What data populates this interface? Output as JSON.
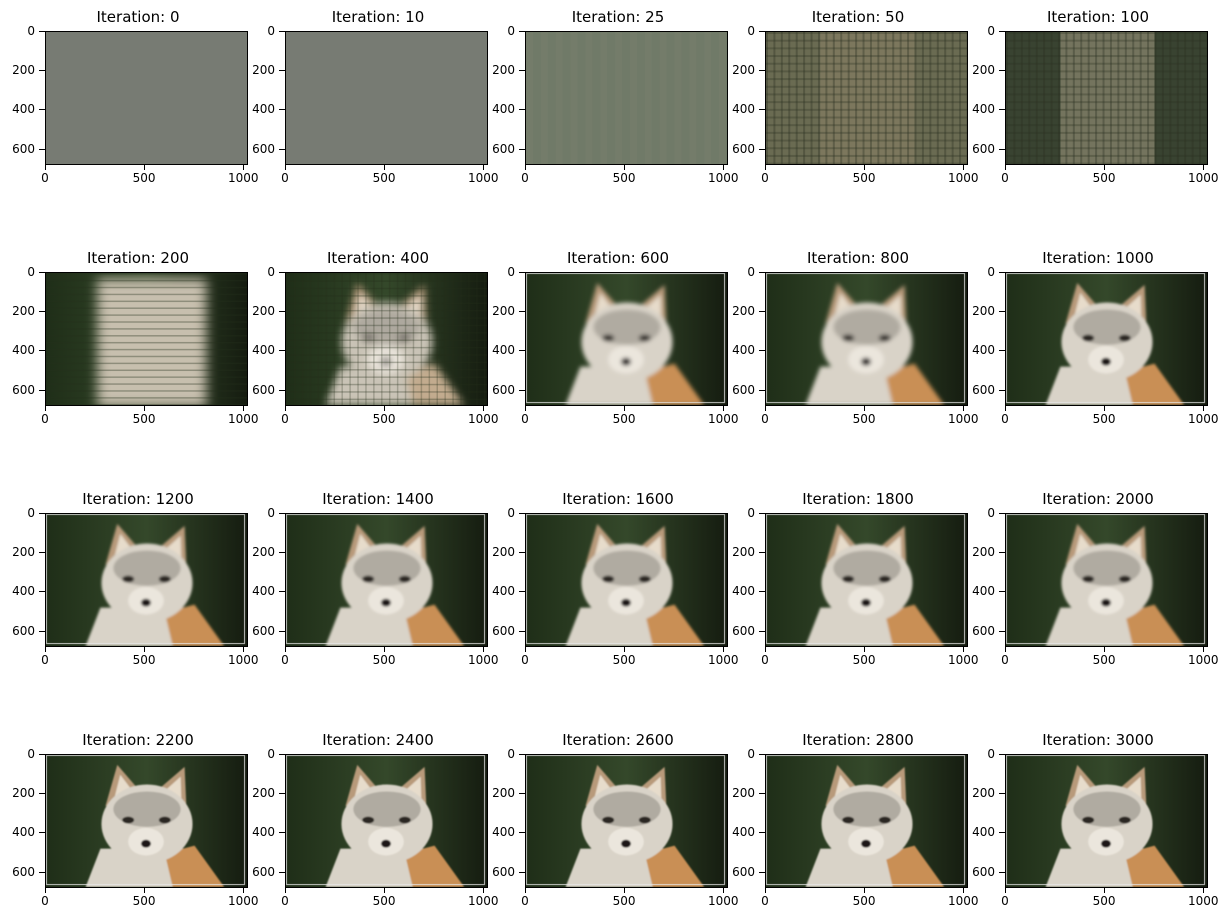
{
  "title_prefix": "Iteration: ",
  "x_ticks": [
    "0",
    "500",
    "1000"
  ],
  "y_ticks": [
    "0",
    "200",
    "400",
    "600"
  ],
  "image_extent": {
    "width": 1024,
    "height": 683
  },
  "panels": [
    {
      "title": "Iteration: 0",
      "iteration": 0,
      "stage": "flat-grey"
    },
    {
      "title": "Iteration: 10",
      "iteration": 10,
      "stage": "flat-grey"
    },
    {
      "title": "Iteration: 25",
      "iteration": 25,
      "stage": "faint-blocks"
    },
    {
      "title": "Iteration: 50",
      "iteration": 50,
      "stage": "plaid"
    },
    {
      "title": "Iteration: 100",
      "iteration": 100,
      "stage": "plaid-dark"
    },
    {
      "title": "Iteration: 200",
      "iteration": 200,
      "stage": "central-blob"
    },
    {
      "title": "Iteration: 400",
      "iteration": 400,
      "stage": "rough-face"
    },
    {
      "title": "Iteration: 600",
      "iteration": 600,
      "stage": "fox-blurry"
    },
    {
      "title": "Iteration: 800",
      "iteration": 800,
      "stage": "fox-blurry"
    },
    {
      "title": "Iteration: 1000",
      "iteration": 1000,
      "stage": "fox"
    },
    {
      "title": "Iteration: 1200",
      "iteration": 1200,
      "stage": "fox"
    },
    {
      "title": "Iteration: 1400",
      "iteration": 1400,
      "stage": "fox"
    },
    {
      "title": "Iteration: 1600",
      "iteration": 1600,
      "stage": "fox"
    },
    {
      "title": "Iteration: 1800",
      "iteration": 1800,
      "stage": "fox"
    },
    {
      "title": "Iteration: 2000",
      "iteration": 2000,
      "stage": "fox"
    },
    {
      "title": "Iteration: 2200",
      "iteration": 2200,
      "stage": "fox-sharp"
    },
    {
      "title": "Iteration: 2400",
      "iteration": 2400,
      "stage": "fox-sharp"
    },
    {
      "title": "Iteration: 2600",
      "iteration": 2600,
      "stage": "fox-sharp"
    },
    {
      "title": "Iteration: 2800",
      "iteration": 2800,
      "stage": "fox-sharp"
    },
    {
      "title": "Iteration: 3000",
      "iteration": 3000,
      "stage": "fox-sharp"
    }
  ],
  "colors": {
    "grey": "#777b73",
    "forest": "#2c3b22",
    "fur_light": "#d9d3c8",
    "fur_grey": "#a8a39a",
    "fur_orange": "#c98f55",
    "ear_tan": "#b89a7a",
    "eye_dark": "#2a2620"
  }
}
